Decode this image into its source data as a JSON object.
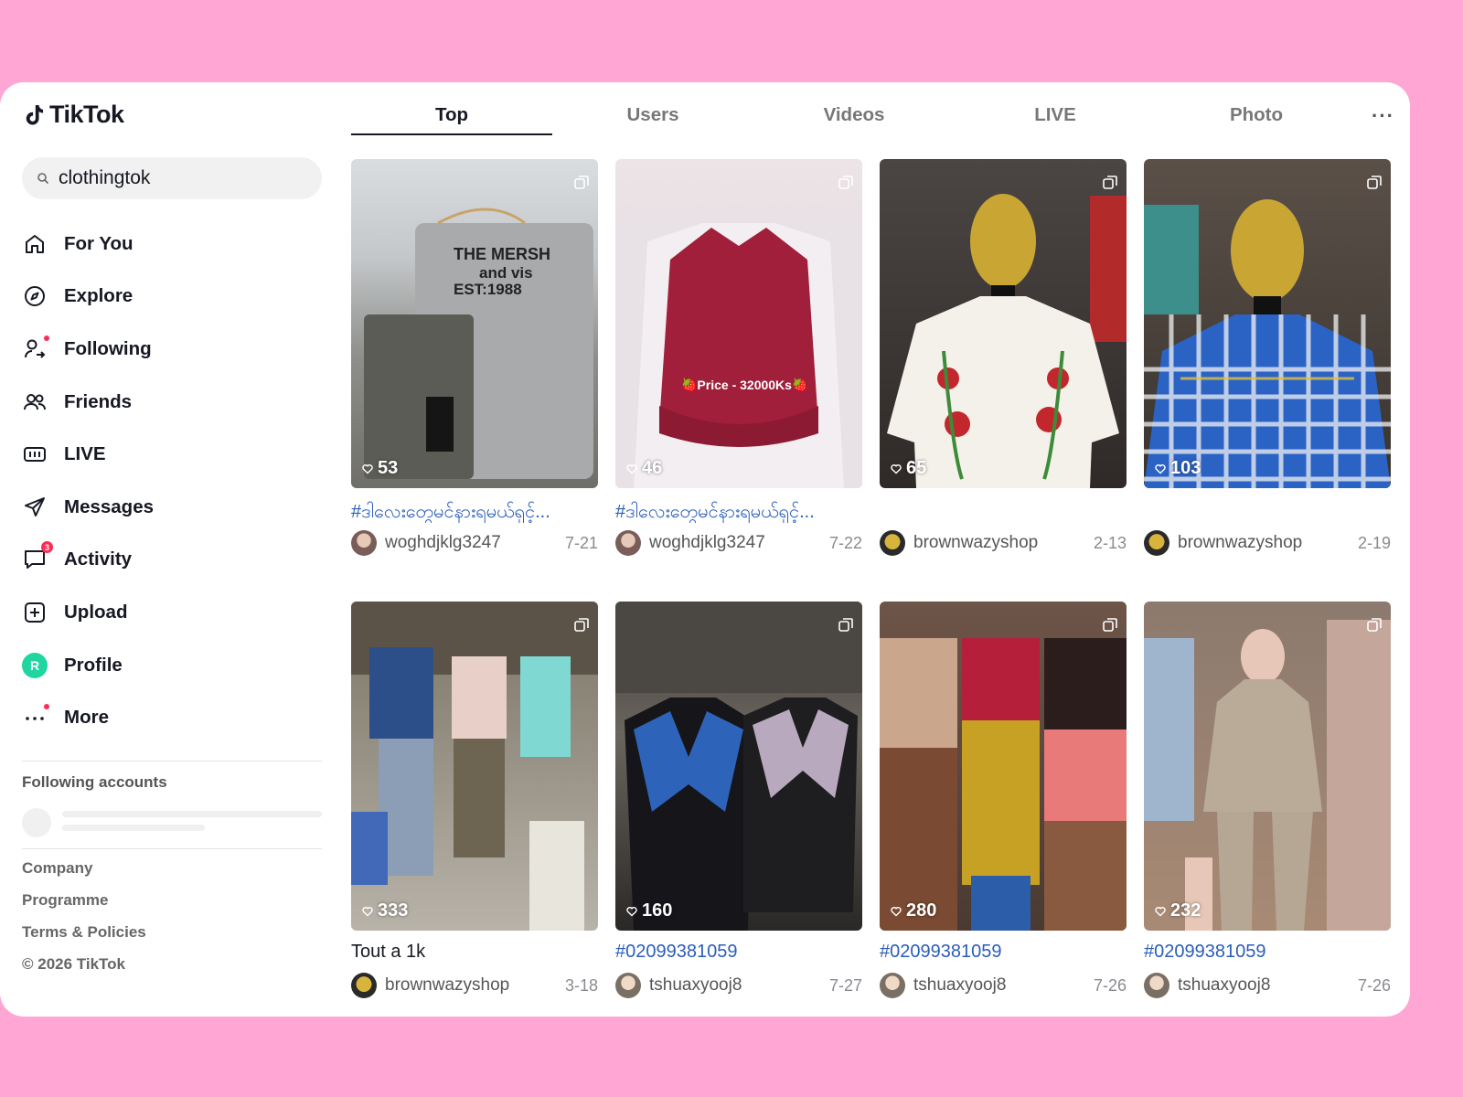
{
  "app": {
    "name": "TikTok"
  },
  "search": {
    "value": "clothingtok"
  },
  "nav": [
    {
      "label": "For You",
      "icon": "home-icon"
    },
    {
      "label": "Explore",
      "icon": "compass-icon"
    },
    {
      "label": "Following",
      "icon": "following-icon"
    },
    {
      "label": "Friends",
      "icon": "friends-icon"
    },
    {
      "label": "LIVE",
      "icon": "live-icon"
    },
    {
      "label": "Messages",
      "icon": "send-icon"
    },
    {
      "label": "Activity",
      "icon": "activity-icon",
      "badge": "3"
    },
    {
      "label": "Upload",
      "icon": "upload-icon"
    },
    {
      "label": "Profile",
      "icon": "profile-avatar",
      "avatar_letter": "R"
    },
    {
      "label": "More",
      "icon": "more-icon"
    }
  ],
  "following": {
    "title": "Following accounts"
  },
  "footer": {
    "links": [
      "Company",
      "Programme",
      "Terms & Policies",
      "© 2026 TikTok"
    ]
  },
  "tabs": [
    "Top",
    "Users",
    "Videos",
    "LIVE",
    "Photo"
  ],
  "videos": [
    {
      "likes": "53",
      "caption": "#ဒါလေးတွေမင်နားရမယ်ရှင့်...",
      "user": "woghdjklg3247",
      "date": "7-21",
      "link": true
    },
    {
      "likes": "46",
      "caption": "#ဒါလေးတွေမင်နားရမယ်ရှင့်...",
      "user": "woghdjklg3247",
      "date": "7-22",
      "link": true
    },
    {
      "likes": "65",
      "caption": "",
      "user": "brownwazyshop",
      "date": "2-13",
      "link": true
    },
    {
      "likes": "103",
      "caption": "",
      "user": "brownwazyshop",
      "date": "2-19",
      "link": true
    },
    {
      "likes": "333",
      "caption": "Tout a 1k",
      "user": "brownwazyshop",
      "date": "3-18",
      "link": false
    },
    {
      "likes": "160",
      "caption": "#02099381059",
      "user": "tshuaxyooj8",
      "date": "7-27",
      "link": true
    },
    {
      "likes": "280",
      "caption": "#02099381059",
      "user": "tshuaxyooj8",
      "date": "7-26",
      "link": true
    },
    {
      "likes": "232",
      "caption": "#02099381059",
      "user": "tshuaxyooj8",
      "date": "7-26",
      "link": true
    }
  ],
  "colors": {
    "accent": "#fe2c55",
    "background": "#ffa6d4",
    "link": "#2b5db9"
  }
}
